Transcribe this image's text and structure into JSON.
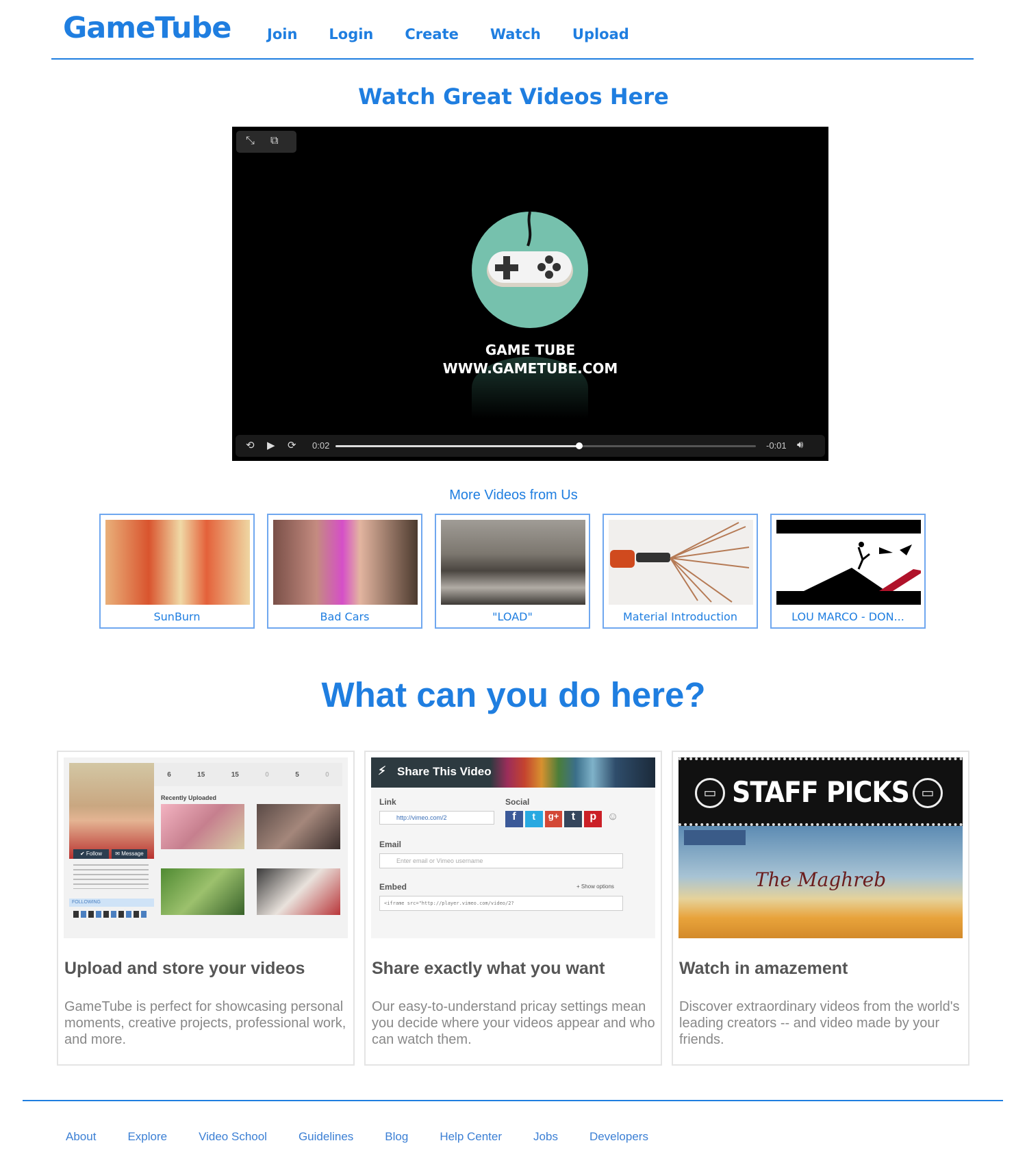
{
  "header": {
    "logo": "GameTube",
    "nav": [
      "Join",
      "Login",
      "Create",
      "Watch",
      "Upload"
    ]
  },
  "hero": {
    "title": "Watch Great Videos Here"
  },
  "player": {
    "line1": "GAME TUBE",
    "line2": "WWW.GAMETUBE.COM",
    "elapsed": "0:02",
    "remaining": "-0:01",
    "progress": 0.58
  },
  "more": {
    "title": "More Videos from Us",
    "videos": [
      "SunBurn",
      "Bad Cars",
      "\"LOAD\"",
      "Material Introduction",
      "LOU MARCO - DON..."
    ]
  },
  "features": {
    "title": "What can you do here?",
    "cards": [
      {
        "title": "Upload and store your videos",
        "text": "GameTube is perfect for showcasing personal moments, creative projects, professional work, and more."
      },
      {
        "title": "Share exactly what you want",
        "text": "Our easy-to-understand pricay settings mean you decide where your videos appear and who can watch them."
      },
      {
        "title": "Watch in amazement",
        "text": "Discover extraordinary videos from the world's leading creators -- and video made by your friends."
      }
    ],
    "upload_shot": {
      "stats": [
        "6",
        "15",
        "15",
        "0",
        "5",
        "0"
      ],
      "recent": "Recently Uploaded",
      "follow": "✔ Follow",
      "message": "✉ Message",
      "following": "FOLLOWING"
    },
    "share_shot": {
      "title": "Share This Video",
      "link_label": "Link",
      "link_value": "http://vimeo.com/2",
      "social_label": "Social",
      "email_label": "Email",
      "email_placeholder": "Enter email or Vimeo username",
      "embed_label": "Embed",
      "show_options": "+ Show options",
      "embed_value": "<iframe src=\"http://player.vimeo.com/video/2?"
    },
    "watch_shot": {
      "banner": "STAFF PICKS",
      "script": "The Maghreb"
    }
  },
  "footer": {
    "links": [
      "About",
      "Explore",
      "Video School",
      "Guidelines",
      "Blog",
      "Help Center",
      "Jobs",
      "Developers"
    ]
  },
  "colors": {
    "brand": "#1f7ee0",
    "pad": "#76c1ad"
  }
}
